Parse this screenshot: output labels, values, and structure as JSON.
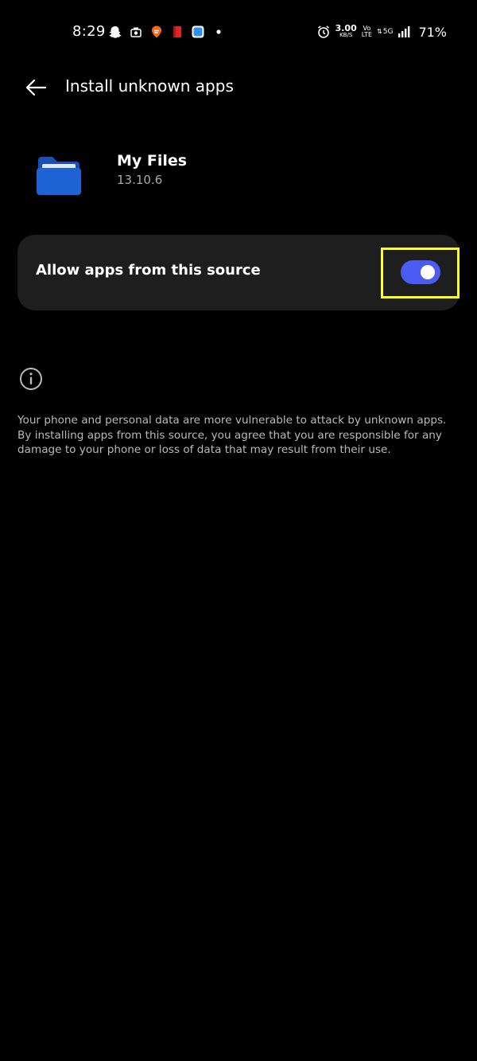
{
  "status_bar": {
    "time": "8:29",
    "net_speed_value": "3.00",
    "net_speed_unit": "KB/S",
    "volte_top": "Vo",
    "volte_bottom": "LTE",
    "network_type": "5G",
    "battery_percent": "71%"
  },
  "app_bar": {
    "title": "Install unknown apps"
  },
  "app_info": {
    "name": "My Files",
    "version": "13.10.6"
  },
  "setting": {
    "label": "Allow apps from this source",
    "enabled": true
  },
  "info": {
    "text": "Your phone and personal data are more vulnerable to attack by unknown apps. By installing apps from this source, you agree that you are responsible for any damage to your phone or loss of data that may result from their use."
  },
  "colors": {
    "background": "#000000",
    "card": "#1e1e1e",
    "toggle_on": "#4b5cf2",
    "highlight": "#ffff1a",
    "folder_blue": "#1e63d6"
  }
}
